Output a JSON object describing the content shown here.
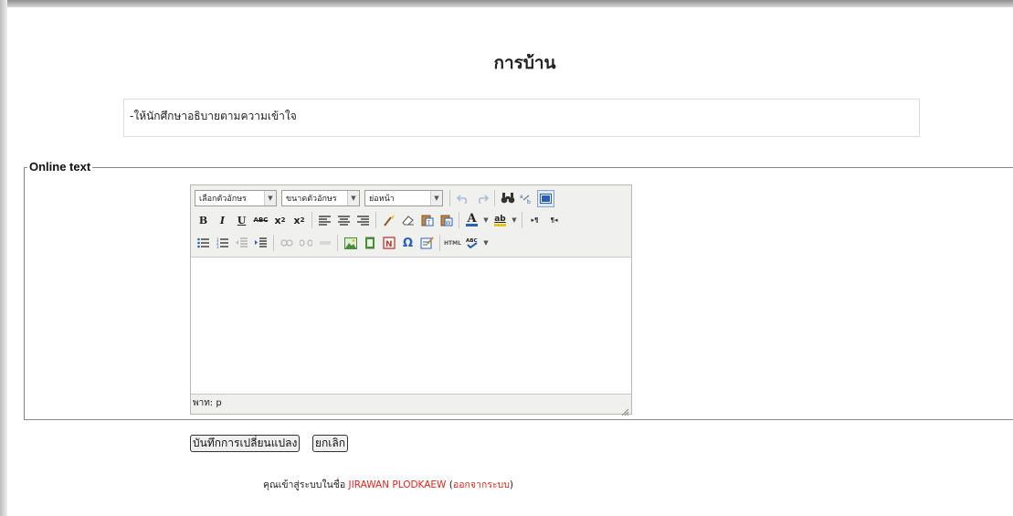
{
  "page": {
    "title": "การบ้าน",
    "description": "-ให้นักศึกษาอธิบายตามความเข้าใจ"
  },
  "fieldset": {
    "legend": "Online text"
  },
  "editor": {
    "font_family_select": "เลือกตัวอักษร",
    "font_size_select": "ขนาดตัวอักษร",
    "format_select": "ย่อหน้า",
    "path_label": "พาท: p",
    "content": ""
  },
  "toolbar_icons": {
    "row1": [
      "undo-icon",
      "redo-icon",
      "find-icon",
      "replace-icon",
      "fullscreen-icon"
    ],
    "row2": [
      "bold-icon",
      "italic-icon",
      "underline-icon",
      "strikethrough-icon",
      "subscript-icon",
      "superscript-icon",
      "align-left-icon",
      "align-center-icon",
      "align-right-icon",
      "cleanup-icon",
      "eraser-icon",
      "paste-text-icon",
      "paste-word-icon",
      "text-color-icon",
      "highlight-color-icon",
      "ltr-icon",
      "rtl-icon"
    ],
    "row3": [
      "bullet-list-icon",
      "numbered-list-icon",
      "outdent-icon",
      "indent-icon",
      "link-icon",
      "unlink-icon",
      "anchor-icon",
      "image-icon",
      "media-icon",
      "emoticon-icon",
      "special-char-icon",
      "insert-table-icon",
      "html-source-icon",
      "spellcheck-icon"
    ]
  },
  "buttons": {
    "save": "บันทึกการเปลี่ยนแปลง",
    "cancel": "ยกเลิก"
  },
  "footer": {
    "logged_in_as": "คุณเข้าสู่ระบบในชื่อ ",
    "user_name": "JIRAWAN PLODKAEW",
    "logout": "ออกจากระบบ"
  },
  "colors": {
    "link_red": "#d9281d",
    "editor_bg": "#f0f0ee"
  }
}
